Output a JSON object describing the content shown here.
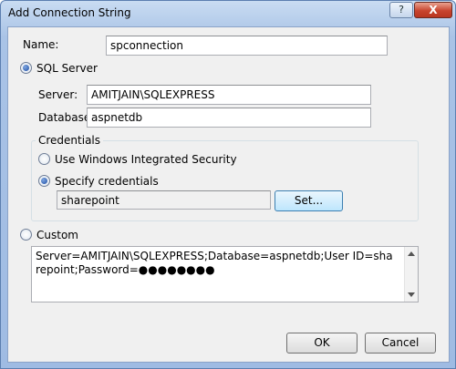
{
  "window": {
    "title": "Add Connection String",
    "help_glyph": "?",
    "close_glyph": "X"
  },
  "name": {
    "label": "Name:",
    "value": "spconnection"
  },
  "sql_server": {
    "label": "SQL Server",
    "selected": true,
    "server_label": "Server:",
    "server_value": "AMITJAIN\\SQLEXPRESS",
    "database_label": "Database:",
    "database_value": "aspnetdb"
  },
  "credentials": {
    "group_title": "Credentials",
    "windows_auth_label": "Use Windows Integrated Security",
    "specify_label": "Specify credentials",
    "specify_selected": true,
    "credential_value": "sharepoint",
    "set_button": "Set..."
  },
  "custom": {
    "label": "Custom",
    "selected": false,
    "connection_string": "Server=AMITJAIN\\SQLEXPRESS;Database=aspnetdb;User ID=sharepoint;Password=●●●●●●●●"
  },
  "buttons": {
    "ok": "OK",
    "cancel": "Cancel"
  }
}
